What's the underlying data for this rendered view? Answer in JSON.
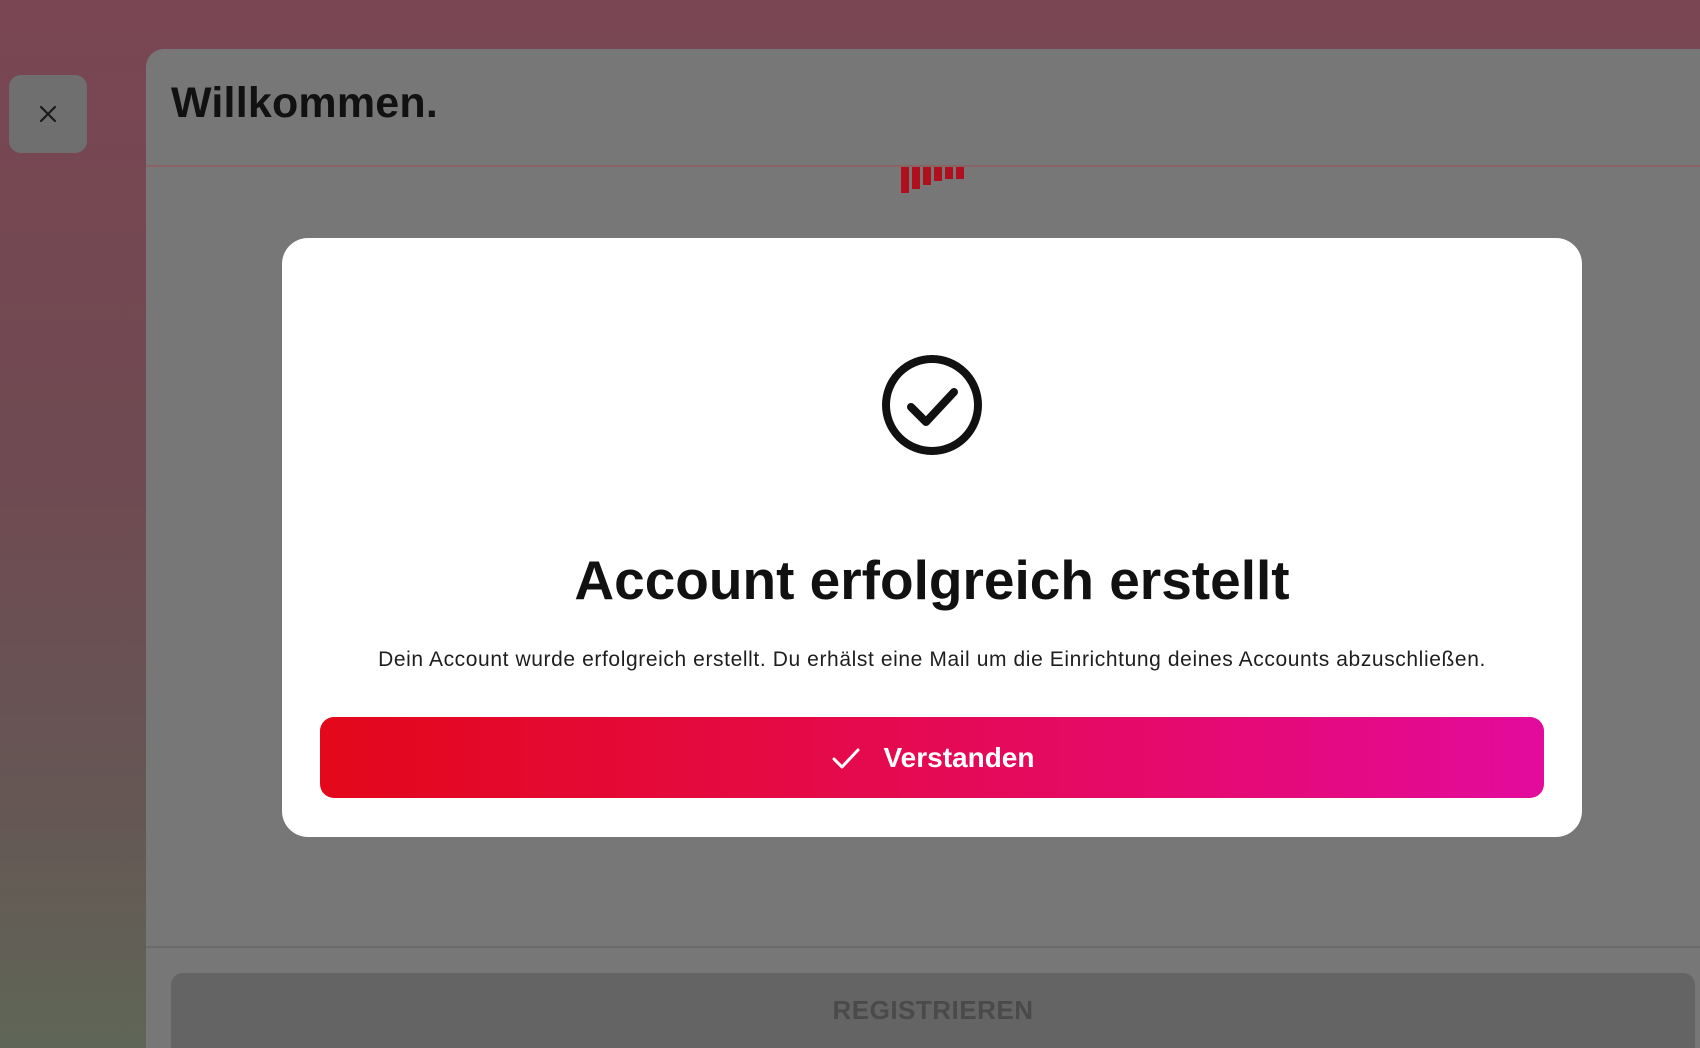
{
  "window": {
    "close_icon": "close-icon"
  },
  "panel": {
    "title": "Willkommen.",
    "register_label": "REGISTRIEREN"
  },
  "modal": {
    "icon": "check-circle-icon",
    "title": "Account erfolgreich erstellt",
    "message": "Dein Account wurde erfolgreich erstellt. Du erhälst eine Mail um die Einrichtung deines Accounts abzuschließen.",
    "confirm_label": "Verstanden",
    "confirm_icon": "checkmark-icon"
  },
  "colors": {
    "accent_start": "#e3081a",
    "accent_end": "#e30b9d",
    "overlay": "#777777"
  }
}
